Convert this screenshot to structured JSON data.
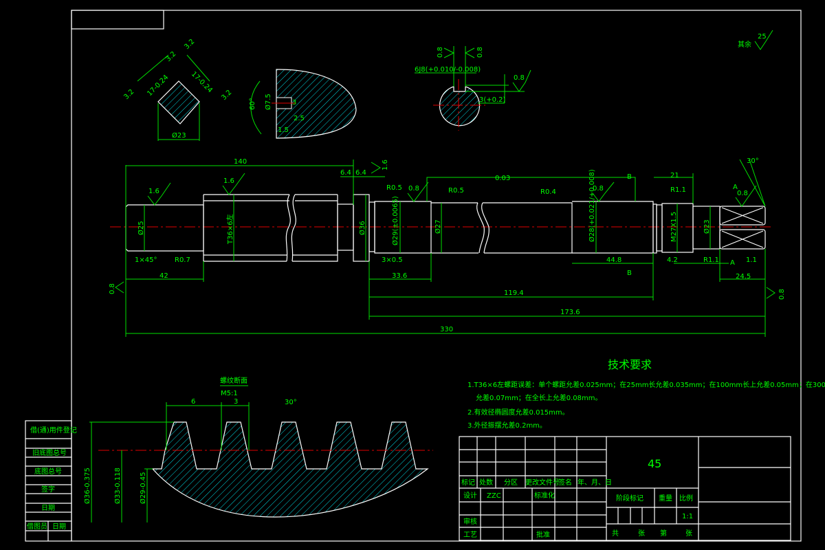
{
  "colors": {
    "background": "#000000",
    "outline": "#ffffff",
    "dimension": "#00ff00",
    "centerline": "#ff0000",
    "hatch": "#00ffff"
  },
  "roughness_note": {
    "label": "其余",
    "value": "25"
  },
  "main_view": {
    "dims": {
      "total_length": "330",
      "left_len": "140",
      "len_42": "42",
      "len_6_4a": "6.4",
      "len_6_4b": "6.4",
      "dia_25": "Ø25",
      "thread": "T36×6左",
      "dia_36": "Ø36",
      "dia_29": "Ø29(±0.0065)",
      "dia_27": "Ø27",
      "dia_28": "Ø28(+0.021/+0.008)",
      "m27": "M27X1.5",
      "dia_23": "Ø23",
      "chamfer": "1×45°",
      "r07": "R0.7",
      "r05a": "R0.5",
      "r05b": "R0.5",
      "r04": "R0.4",
      "groove": "3×0.5",
      "len_33_6": "33.6",
      "len_119_4": "119.4",
      "len_173_6": "173.6",
      "len_44_8": "44.8",
      "len_4_2": "4.2",
      "len_21": "21",
      "r11a": "R1.1",
      "r11b": "R1.1",
      "len_1_1": "1.1",
      "len_24_5": "24.5",
      "angle_30": "30°",
      "runout": "0.03",
      "section_b": "B",
      "section_a": "A"
    },
    "roughness": [
      "1.6",
      "1.6",
      "1.6",
      "0.8",
      "0.8",
      "0.8",
      "0.8",
      "0.8",
      "0.8"
    ]
  },
  "square_section": {
    "dim_width": "Ø23",
    "dim_a": "17-0.24",
    "dim_b": "17-0.24",
    "roughness": [
      "3.2",
      "3.2",
      "3.2",
      "3.2"
    ]
  },
  "key_section_a": {
    "angle": "60°",
    "dia": "Ø7.5",
    "d1": "2.5",
    "d2": "1.5",
    "d3": "3"
  },
  "key_section_b": {
    "keyway": "6J8(+0.010/-0.008)",
    "depth": "3(+0.2)",
    "roughness": [
      "0.8",
      "0.8",
      "0.8"
    ]
  },
  "thread_section": {
    "title": "螺纹断面",
    "scale": "M5:1",
    "pitch": "6",
    "half": "3",
    "angle": "30°",
    "dia_outer": "Ø36-0.375",
    "dia_pitch": "Ø33-0.118",
    "dia_root": "Ø29-0.45"
  },
  "tech_requirements": {
    "title": "技术要求",
    "items": [
      "1.T36×6左螺距误差：单个螺距允差0.025mm；在25mm长允差0.035mm；在100mm长上允差0.05mm；在300mm长上",
      "允差0.07mm；在全长上允差0.08mm。",
      "2.有效径椭圆度允差0.015mm。",
      "3.外径振摆允差0.2mm。"
    ]
  },
  "side_column": [
    "借(通)用件登记",
    "旧底图总号",
    "底图总号",
    "签字",
    "日期",
    "借图员",
    "日期"
  ],
  "title_block": {
    "material": "45",
    "header": [
      "标记",
      "处数",
      "分区",
      "更改文件号",
      "签名",
      "年、月、日"
    ],
    "design_label": "设计",
    "designer": "ZZC",
    "standardize": "标准化",
    "review": "审核",
    "process": "工艺",
    "approve": "批准",
    "stage_mark": "阶段标记",
    "weight": "重量",
    "scale_label": "比例",
    "scale": "1:1",
    "total": "共",
    "sheets": "张",
    "nth": "第",
    "sheet": "张"
  }
}
